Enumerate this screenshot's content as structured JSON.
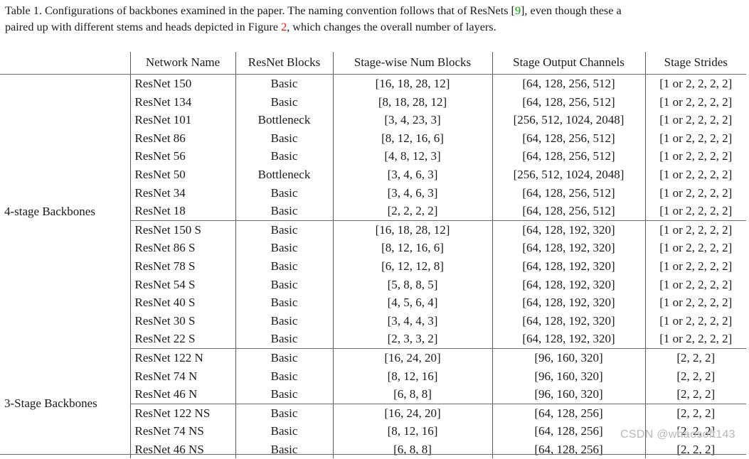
{
  "caption": {
    "line1_a": "Table 1. Configurations of backbones examined in the paper. The naming convention follows that of ResNets [",
    "line1_ref": "9",
    "line1_b": "], even though these a",
    "line2_a": "paired up with different stems and heads depicted in Figure ",
    "line2_ref": "2",
    "line2_b": ", which changes the overall number of layers."
  },
  "table": {
    "columns": [
      {
        "key": "group",
        "label": ""
      },
      {
        "key": "name",
        "label": "Network Name"
      },
      {
        "key": "blocks",
        "label": "ResNet Blocks"
      },
      {
        "key": "nums",
        "label": "Stage-wise Num Blocks"
      },
      {
        "key": "channels",
        "label": "Stage Output Channels"
      },
      {
        "key": "strides",
        "label": "Stage Strides"
      }
    ],
    "groups": [
      {
        "label": "4-stage Backbones",
        "subgroups": [
          {
            "rows": [
              {
                "name": "ResNet 150",
                "blocks": "Basic",
                "nums": "[16, 18, 28, 12]",
                "channels": "[64, 128, 256, 512]",
                "strides": "[1 or 2, 2, 2, 2]"
              },
              {
                "name": "ResNet 134",
                "blocks": "Basic",
                "nums": "[8, 18, 28, 12]",
                "channels": "[64, 128, 256, 512]",
                "strides": "[1 or 2, 2, 2, 2]"
              },
              {
                "name": "ResNet 101",
                "blocks": "Bottleneck",
                "nums": "[3, 4, 23, 3]",
                "channels": "[256, 512, 1024, 2048]",
                "strides": "[1 or 2, 2, 2, 2]"
              },
              {
                "name": "ResNet 86",
                "blocks": "Basic",
                "nums": "[8, 12, 16, 6]",
                "channels": "[64, 128, 256, 512]",
                "strides": "[1 or 2, 2, 2, 2]"
              },
              {
                "name": "ResNet 56",
                "blocks": "Basic",
                "nums": "[4, 8, 12, 3]",
                "channels": "[64, 128, 256, 512]",
                "strides": "[1 or 2, 2, 2, 2]"
              },
              {
                "name": "ResNet 50",
                "blocks": "Bottleneck",
                "nums": "[3, 4, 6, 3]",
                "channels": "[256, 512, 1024, 2048]",
                "strides": "[1 or 2, 2, 2, 2]"
              },
              {
                "name": "ResNet 34",
                "blocks": "Basic",
                "nums": "[3, 4, 6, 3]",
                "channels": "[64, 128, 256, 512]",
                "strides": "[1 or 2, 2, 2, 2]"
              },
              {
                "name": "ResNet 18",
                "blocks": "Basic",
                "nums": "[2, 2, 2, 2]",
                "channels": "[64, 128, 256, 512]",
                "strides": "[1 or 2, 2, 2, 2]"
              }
            ]
          },
          {
            "rows": [
              {
                "name": "ResNet 150 S",
                "blocks": "Basic",
                "nums": "[16, 18, 28, 12]",
                "channels": "[64, 128, 192, 320]",
                "strides": "[1 or 2, 2, 2, 2]"
              },
              {
                "name": "ResNet 86 S",
                "blocks": "Basic",
                "nums": "[8, 12, 16, 6]",
                "channels": "[64, 128, 192, 320]",
                "strides": "[1 or 2, 2, 2, 2]"
              },
              {
                "name": "ResNet 78 S",
                "blocks": "Basic",
                "nums": "[6, 12, 12, 8]",
                "channels": "[64, 128, 192, 320]",
                "strides": "[1 or 2, 2, 2, 2]"
              },
              {
                "name": "ResNet 54 S",
                "blocks": "Basic",
                "nums": "[5, 8, 8, 5]",
                "channels": "[64, 128, 192, 320]",
                "strides": "[1 or 2, 2, 2, 2]"
              },
              {
                "name": "ResNet 40 S",
                "blocks": "Basic",
                "nums": "[4, 5, 6, 4]",
                "channels": "[64, 128, 192, 320]",
                "strides": "[1 or 2, 2, 2, 2]"
              },
              {
                "name": "ResNet 30 S",
                "blocks": "Basic",
                "nums": "[3, 4, 4, 3]",
                "channels": "[64, 128, 192, 320]",
                "strides": "[1 or 2, 2, 2, 2]"
              },
              {
                "name": "ResNet 22 S",
                "blocks": "Basic",
                "nums": "[2, 3, 3, 2]",
                "channels": "[64, 128, 192, 320]",
                "strides": "[1 or 2, 2, 2, 2]"
              }
            ]
          }
        ]
      },
      {
        "label": "3-Stage Backbones",
        "subgroups": [
          {
            "rows": [
              {
                "name": "ResNet 122 N",
                "blocks": "Basic",
                "nums": "[16, 24, 20]",
                "channels": "[96, 160, 320]",
                "strides": "[2, 2, 2]"
              },
              {
                "name": "ResNet 74 N",
                "blocks": "Basic",
                "nums": "[8, 12, 16]",
                "channels": "[96, 160, 320]",
                "strides": "[2, 2, 2]"
              },
              {
                "name": "ResNet 46 N",
                "blocks": "Basic",
                "nums": "[6, 8, 8]",
                "channels": "[96, 160, 320]",
                "strides": "[2, 2, 2]"
              }
            ]
          },
          {
            "rows": [
              {
                "name": "ResNet 122 NS",
                "blocks": "Basic",
                "nums": "[16, 24, 20]",
                "channels": "[64, 128, 256]",
                "strides": "[2, 2, 2]"
              },
              {
                "name": "ResNet 74 NS",
                "blocks": "Basic",
                "nums": "[8, 12, 16]",
                "channels": "[64, 128, 256]",
                "strides": "[2, 2, 2]"
              },
              {
                "name": "ResNet 46 NS",
                "blocks": "Basic",
                "nums": "[6, 8, 8]",
                "channels": "[64, 128, 256]",
                "strides": "[2, 2, 2]"
              }
            ]
          }
        ]
      }
    ]
  },
  "watermark": {
    "text": "CSDN @whaosoft143"
  },
  "colors": {
    "citation_green": "#00a000",
    "figure_red": "#e01b1b",
    "rule": "#6b6b6b",
    "text": "#1a1a1a",
    "watermark": "#b9b9b9"
  }
}
